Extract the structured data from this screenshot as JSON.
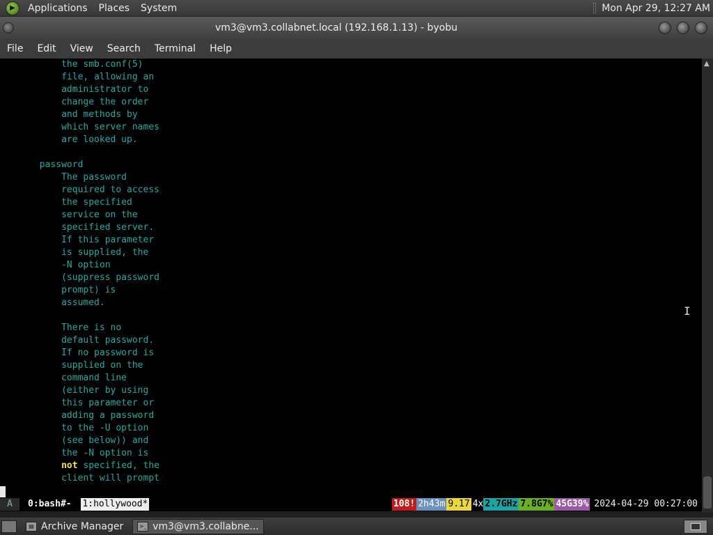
{
  "top_panel": {
    "menus": [
      "Applications",
      "Places",
      "System"
    ],
    "clock": "Mon Apr 29, 12:27 AM"
  },
  "window": {
    "title": "vm3@vm3.collabnet.local (192.168.1.13) - byobu"
  },
  "menubar": [
    "File",
    "Edit",
    "View",
    "Search",
    "Terminal",
    "Help"
  ],
  "terminal": {
    "lines": [
      {
        "text": "           the smb.conf(5)"
      },
      {
        "text": "           file, allowing an"
      },
      {
        "text": "           administrator to"
      },
      {
        "text": "           change the order"
      },
      {
        "text": "           and methods by"
      },
      {
        "text": "           which server names"
      },
      {
        "text": "           are looked up."
      },
      {
        "text": ""
      },
      {
        "text": "       password"
      },
      {
        "text": "           The password"
      },
      {
        "text": "           required to access"
      },
      {
        "text": "           the specified"
      },
      {
        "text": "           service on the"
      },
      {
        "text": "           specified server."
      },
      {
        "text": "           If this parameter"
      },
      {
        "text": "           is supplied, the"
      },
      {
        "text": "           -N option"
      },
      {
        "text": "           (suppress password"
      },
      {
        "text": "           prompt) is"
      },
      {
        "text": "           assumed."
      },
      {
        "text": ""
      },
      {
        "text": "           There is no"
      },
      {
        "text": "           default password."
      },
      {
        "text": "           If no password is"
      },
      {
        "text": "           supplied on the"
      },
      {
        "text": "           command line"
      },
      {
        "text": "           (either by using"
      },
      {
        "text": "           this parameter or"
      },
      {
        "text": "           adding a password"
      },
      {
        "text": "           to the -U option"
      },
      {
        "text": "           (see below)) and"
      },
      {
        "text": "           the -N option is"
      },
      {
        "text": "           ",
        "bold": "not",
        "rest": " specified, the"
      },
      {
        "text": "           client will prompt"
      }
    ]
  },
  "statusbar": {
    "logo": "A",
    "window0": "0:bash#-",
    "window1": "1:hollywood*",
    "updates": "108!",
    "uptime": "2h43m",
    "load": "9.17",
    "cpu_count": "4x",
    "cpu_freq": "2.7GHz",
    "mem": "7.8G7%",
    "disk": "45G39%",
    "datetime": "2024-04-29 00:27:00"
  },
  "taskbar": {
    "tasks": [
      {
        "label": "Archive Manager",
        "icon": "archive-manager-icon"
      },
      {
        "label": "vm3@vm3.collabne...",
        "icon": "terminal-icon"
      }
    ]
  }
}
